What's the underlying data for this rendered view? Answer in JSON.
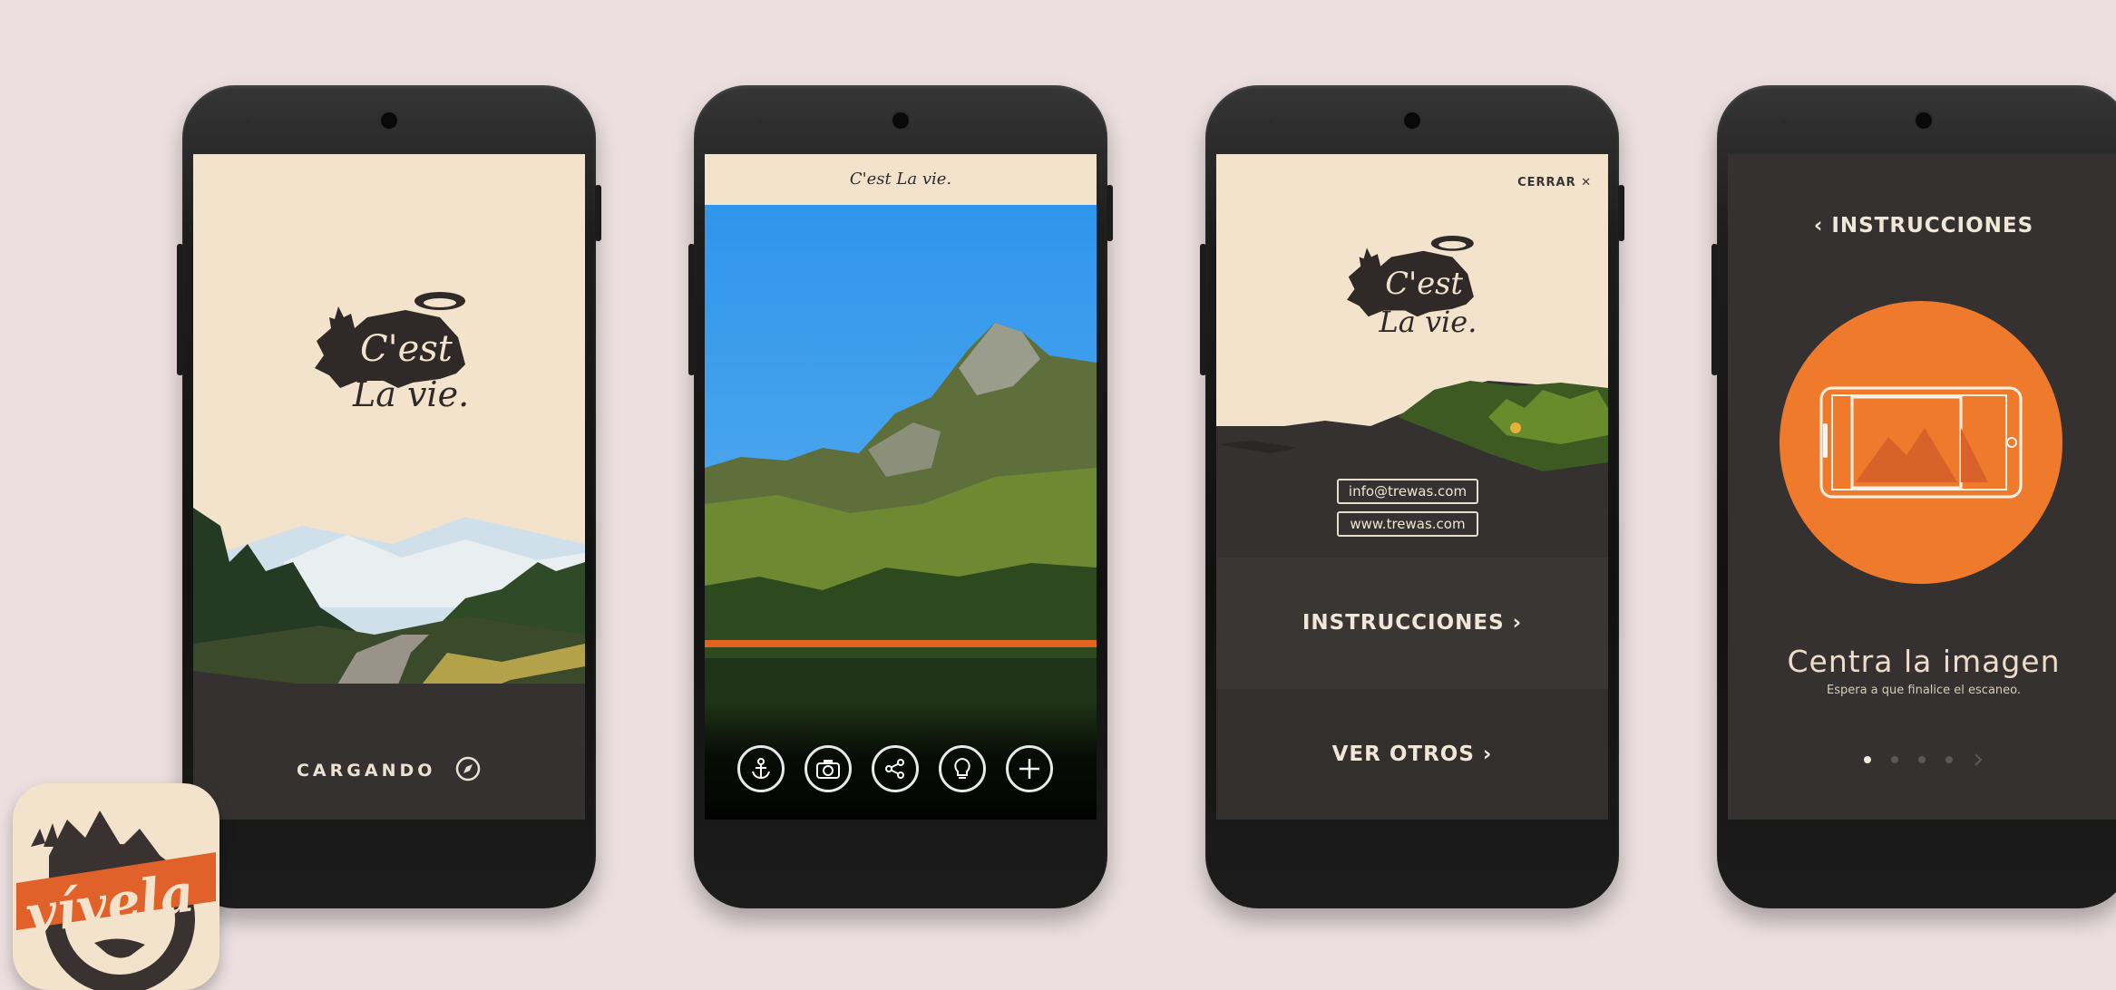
{
  "brand": {
    "name": "C'est La vie.",
    "app_icon_text": "vívela"
  },
  "screen_loading": {
    "status": "CARGANDO"
  },
  "screen_scan": {
    "header_brand": "C'est La vie.",
    "tools": [
      "anchor-icon",
      "camera-icon",
      "share-icon",
      "bulb-icon",
      "plus-icon"
    ]
  },
  "screen_menu": {
    "close": "CERRAR ✕",
    "email": "info@trewas.com",
    "website": "www.trewas.com",
    "instructions": "INSTRUCCIONES ›",
    "others": "VER OTROS ›"
  },
  "screen_instructions": {
    "back": "‹ INSTRUCCIONES",
    "title": "Centra la imagen",
    "subtitle": "Espera a que finalice el escaneo.",
    "page_count": 4,
    "current_page": 1
  },
  "colors": {
    "background": "#ebdfe0",
    "cream": "#f3e3cc",
    "dark": "#353131",
    "accent": "#f07a2c"
  }
}
